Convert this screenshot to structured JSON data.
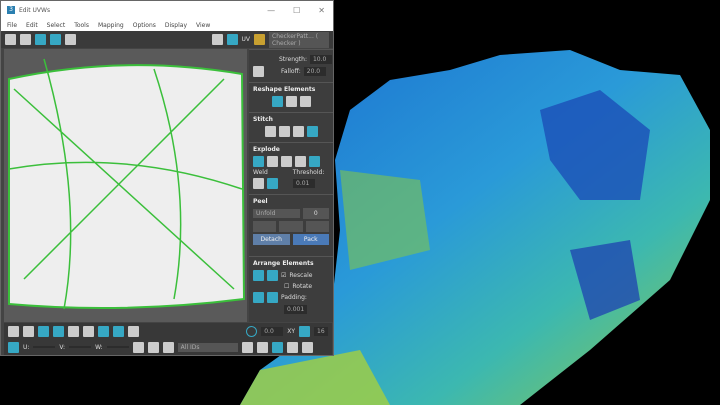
{
  "window": {
    "title": "Edit UVWs",
    "min": "—",
    "max": "☐",
    "close": "✕",
    "logo": "3"
  },
  "menu": [
    "File",
    "Edit",
    "Select",
    "Tools",
    "Mapping",
    "Options",
    "Display",
    "View"
  ],
  "toolbar": {
    "uv_label": "UV",
    "texture_dropdown": "CheckerPatt... ( Checker )"
  },
  "panel": {
    "strength_label": "Strength:",
    "strength": "10.0",
    "falloff_label": "Falloff:",
    "falloff": "20.0",
    "reshape": "Reshape Elements",
    "stitch": "Stitch",
    "explode": "Explode",
    "weld": "Weld",
    "threshold_label": "Threshold:",
    "threshold": "0.01",
    "peel": "Peel",
    "unfold_select": "Unfold",
    "zero_button": "0",
    "detach": "Detach",
    "pack": "Pack",
    "arrange": "Arrange Elements",
    "rescale": "Rescale",
    "rotate": "Rotate",
    "padding_label": "Padding:",
    "padding": "0.001"
  },
  "bottom": {
    "angle": "0.0",
    "xy": "XY",
    "grid": "16",
    "u_label": "U:",
    "v_label": "V:",
    "w_label": "W:",
    "ids_dropdown": "All IDs"
  }
}
